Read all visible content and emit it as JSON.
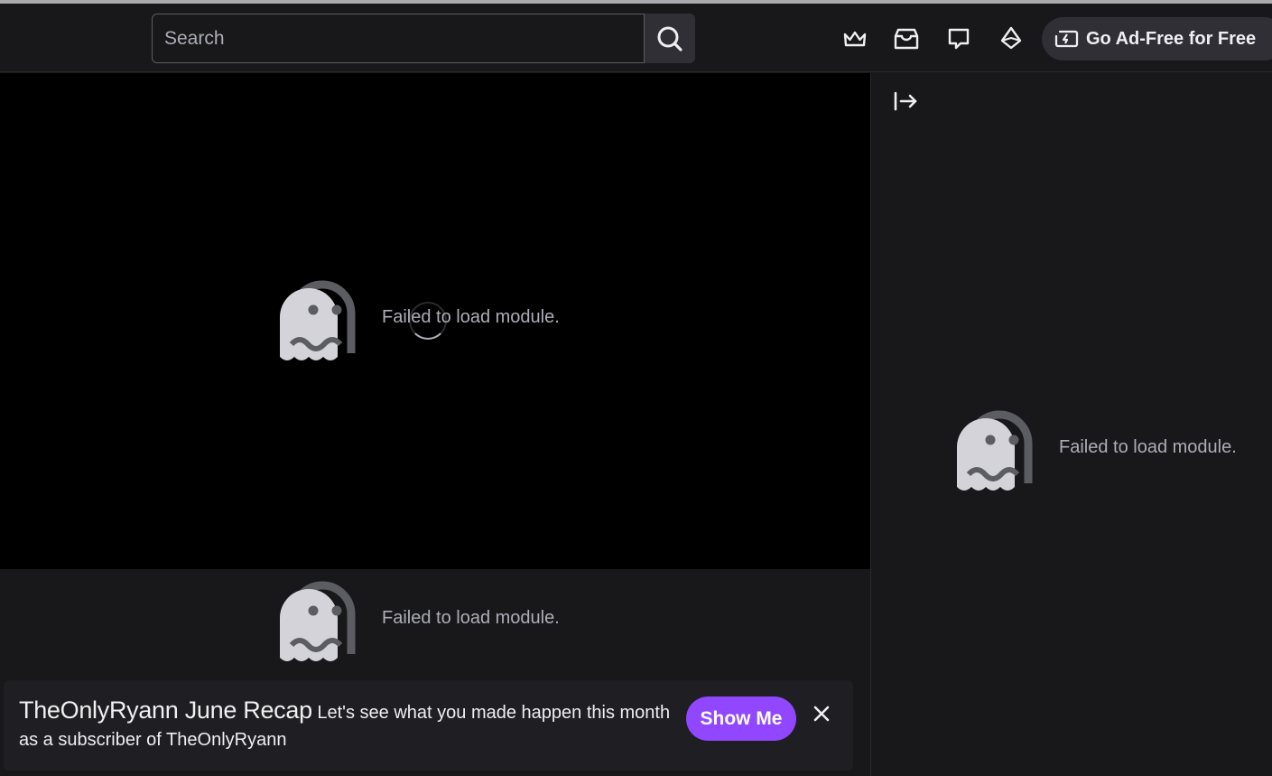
{
  "header": {
    "search": {
      "placeholder": "Search",
      "value": ""
    },
    "icons": [
      "crown-icon",
      "inbox-icon",
      "whispers-icon",
      "bits-icon"
    ],
    "adfree_label": "Go Ad-Free for Free"
  },
  "player": {
    "error": "Failed to load module."
  },
  "below_player": {
    "error": "Failed to load module."
  },
  "sidebar": {
    "error": "Failed to load module."
  },
  "recap": {
    "title": "TheOnlyRyann June Recap",
    "body": "Let's see what you made happen this month as a subscriber of TheOnlyRyann",
    "button": "Show Me"
  },
  "colors": {
    "accent": "#9147ff",
    "background": "#18181b",
    "player": "#000000",
    "muted_text": "#adadb8"
  }
}
